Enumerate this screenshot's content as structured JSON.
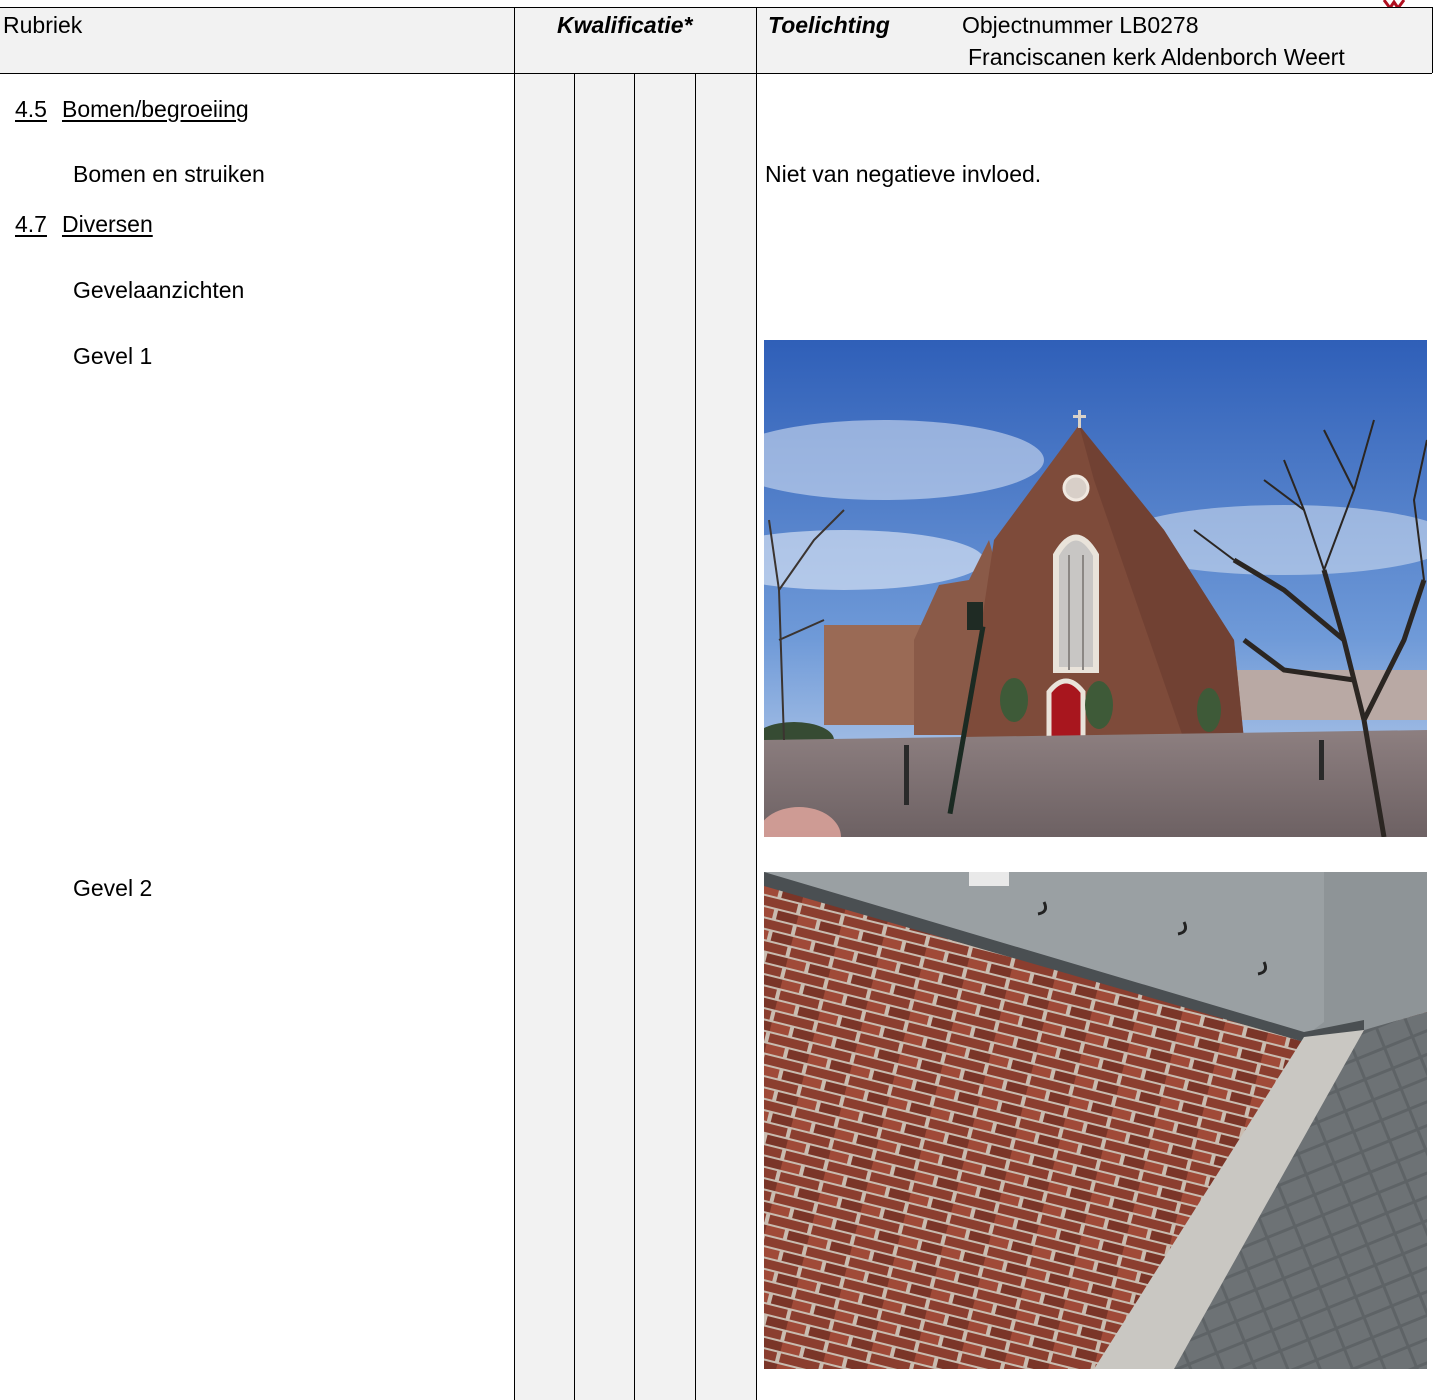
{
  "header": {
    "col_rubriek": "Rubriek",
    "col_kwalificatie": "Kwalificatie*",
    "col_toelichting": "Toelichting",
    "object_number": "Objectnummer LB0278",
    "object_name": "Franciscanen kerk Aldenborch Weert"
  },
  "rows": {
    "section_45": {
      "number": "4.5",
      "title": "Bomen/begroeiing"
    },
    "trees_label": "Bomen en struiken",
    "trees_note": "Niet van negatieve invloed.",
    "section_47": {
      "number": "4.7",
      "title": "Diversen"
    },
    "facade_views": "Gevelaanzichten",
    "gevel1": "Gevel 1",
    "gevel2": "Gevel 2"
  },
  "colors": {
    "header_shade": "#f2f2f2",
    "logo_red": "#b01020"
  },
  "images": {
    "photo1": "church-facade-photo",
    "photo2": "brick-wall-roof-photo"
  }
}
